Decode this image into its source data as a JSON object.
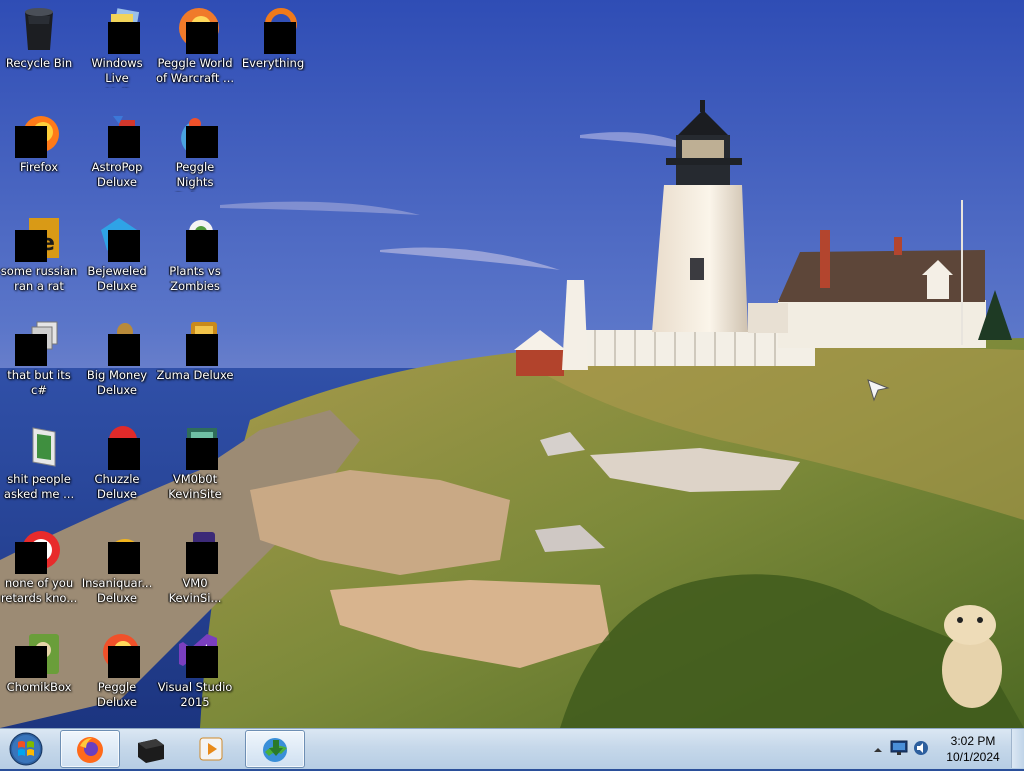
{
  "desktop": {
    "icons": [
      {
        "label": "Recycle Bin",
        "icon": "recycle-bin-icon"
      },
      {
        "label": "Windows Live\nMail",
        "icon": "windows-live-mail-icon"
      },
      {
        "label": "Peggle World\nof Warcraft ...",
        "icon": "peggle-world-of-warcraft-icon"
      },
      {
        "label": "Everything",
        "icon": "everything-search-icon"
      },
      {
        "label": "Firefox",
        "icon": "firefox-icon"
      },
      {
        "label": "AstroPop\nDeluxe",
        "icon": "astropop-icon"
      },
      {
        "label": "Peggle Nights\nDeluxe",
        "icon": "peggle-nights-icon"
      },
      {
        "label": "some russian\nran a rat",
        "icon": "cursed-app-icon"
      },
      {
        "label": "Bejeweled\nDeluxe",
        "icon": "bejeweled-icon"
      },
      {
        "label": "Plants vs\nZombies",
        "icon": "plants-vs-zombies-icon"
      },
      {
        "label": "that but its c#",
        "icon": "stacked-windows-icon"
      },
      {
        "label": "Big Money\nDeluxe",
        "icon": "big-money-icon"
      },
      {
        "label": "Zuma Deluxe",
        "icon": "zuma-icon"
      },
      {
        "label": "shit people\nasked me ...",
        "icon": "folder-icon"
      },
      {
        "label": "Chuzzle\nDeluxe",
        "icon": "chuzzle-icon"
      },
      {
        "label": "VM0b0t\nKevinSite",
        "icon": "vm-shortcut-icon"
      },
      {
        "label": "none of you\nretards kno...",
        "icon": "opera-like-icon"
      },
      {
        "label": "Insaniquar...\nDeluxe",
        "icon": "insaniquarium-icon"
      },
      {
        "label": "VM0\nKevinSi...",
        "icon": "vm-purple-icon"
      },
      {
        "label": "ChomikBox",
        "icon": "chomikbox-icon"
      },
      {
        "label": "Peggle Deluxe",
        "icon": "peggle-deluxe-icon"
      },
      {
        "label": "Visual Studio\n2015",
        "icon": "visual-studio-icon"
      }
    ]
  },
  "taskbar": {
    "start": {
      "icon": "windows-start-orb-icon"
    },
    "pinned": [
      {
        "name": "firefox",
        "icon": "firefox-icon",
        "active": true
      },
      {
        "name": "terminal",
        "icon": "black-box-icon",
        "active": false
      },
      {
        "name": "media-player",
        "icon": "play-icon",
        "active": false
      },
      {
        "name": "download-manager",
        "icon": "download-globe-icon",
        "active": true
      }
    ],
    "tray": {
      "icons": [
        "show-hidden-icons-chevron-icon",
        "monitor-network-icon",
        "speaker-icon"
      ],
      "time": "3:02 PM",
      "date": "10/1/2024"
    }
  },
  "colors": {
    "taskbar_top": "#dbe7f3",
    "taskbar_bottom": "#b6cde4",
    "sky_top": "#2e4fb3",
    "sea": "#1f3f8c"
  }
}
